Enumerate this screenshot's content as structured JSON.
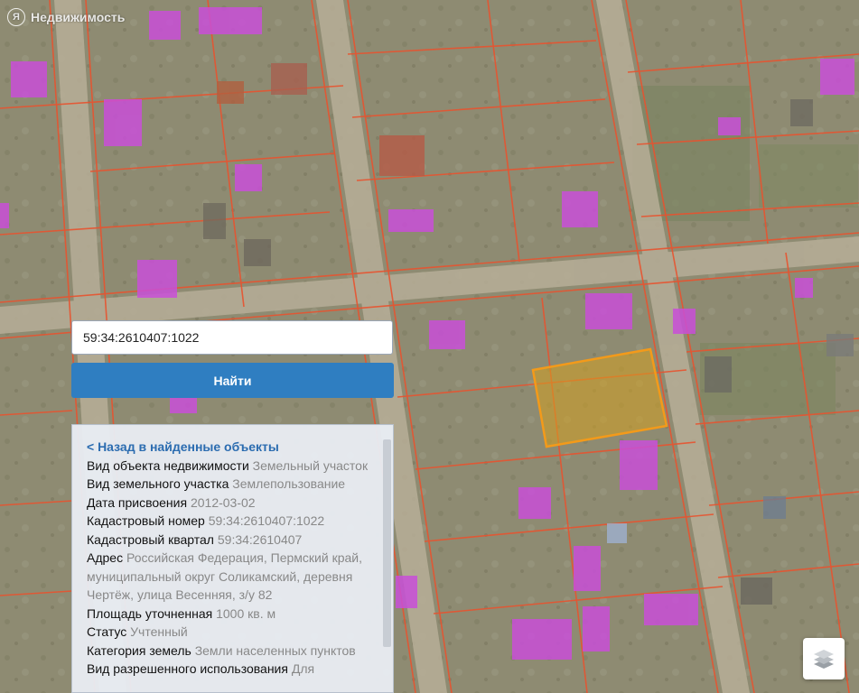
{
  "brand": {
    "logo_letter": "Я",
    "name": "Недвижимость"
  },
  "search": {
    "value": "59:34:2610407:1022"
  },
  "find_button": {
    "label": "Найти"
  },
  "info_panel": {
    "back_link": "< Назад в найденные объекты",
    "rows": [
      {
        "label": "Вид объекта недвижимости",
        "value": "Земельный участок"
      },
      {
        "label": "Вид земельного участка",
        "value": "Землепользование"
      },
      {
        "label": "Дата присвоения",
        "value": "2012-03-02"
      },
      {
        "label": "Кадастровый номер",
        "value": "59:34:2610407:1022"
      },
      {
        "label": "Кадастровый квартал",
        "value": "59:34:2610407"
      },
      {
        "label": "Адрес",
        "value": "Российская Федерация, Пермский край, муниципальный округ Соликамский, деревня Чертёж, улица Весенняя, з/у 82"
      },
      {
        "label": "Площадь уточненная",
        "value": "1000 кв. м"
      },
      {
        "label": "Статус",
        "value": "Учтенный"
      },
      {
        "label": "Категория земель",
        "value": "Земли населенных пунктов"
      },
      {
        "label": "Вид разрешенного использования",
        "value": "Для"
      }
    ]
  },
  "map": {
    "icons": {
      "layers": "layers-icon"
    },
    "colors": {
      "parcel_boundary": "#e8532f",
      "building": "#c94fd8",
      "selected_parcel_fill": "#d4a020",
      "selected_parcel_border": "#f39a1a"
    }
  }
}
